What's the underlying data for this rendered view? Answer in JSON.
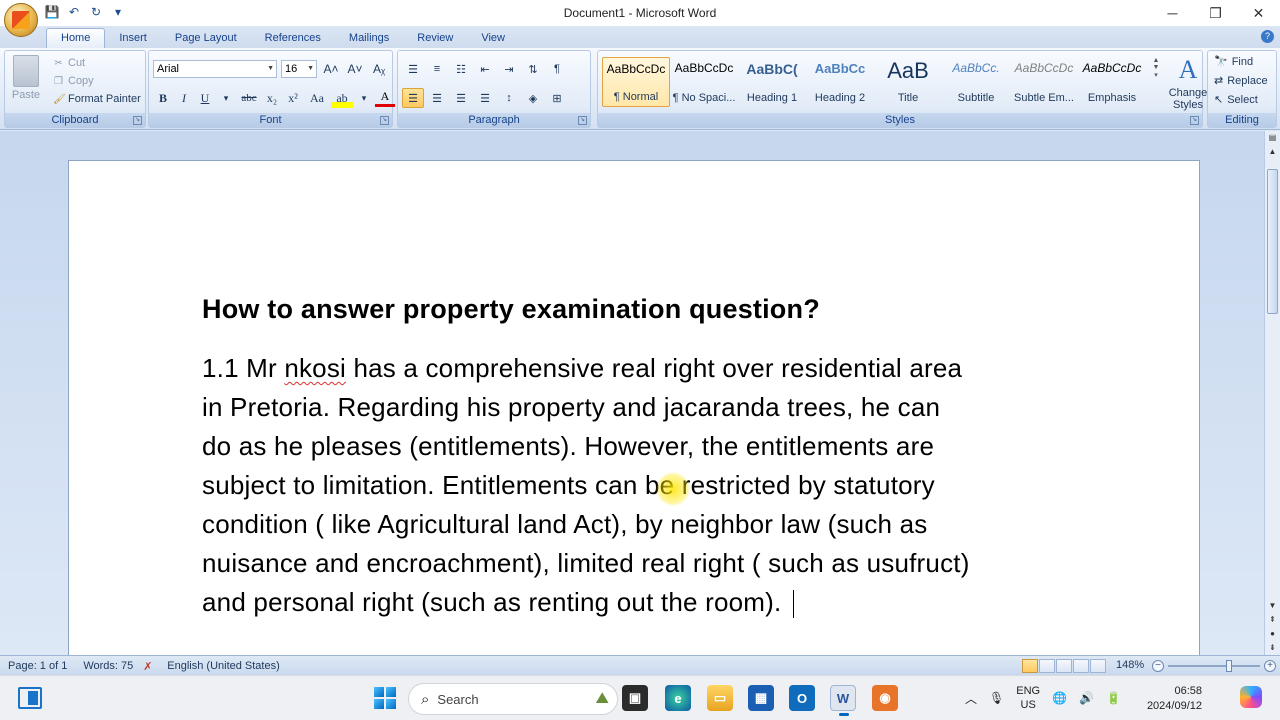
{
  "window": {
    "title": "Document1 - Microsoft Word",
    "controls": {
      "minimize": "─",
      "restore": "❐",
      "close": "✕"
    }
  },
  "qat": {
    "save": "💾",
    "undo": "↶",
    "redo": "↻",
    "more": "▾"
  },
  "tabs": [
    {
      "label": "Home",
      "active": true
    },
    {
      "label": "Insert"
    },
    {
      "label": "Page Layout"
    },
    {
      "label": "References"
    },
    {
      "label": "Mailings"
    },
    {
      "label": "Review"
    },
    {
      "label": "View"
    }
  ],
  "help": "?",
  "clipboard": {
    "paste": "Paste",
    "cut": "Cut",
    "copy": "Copy",
    "format_painter": "Format Painter",
    "group_label": "Clipboard"
  },
  "font": {
    "name": "Arial",
    "size": "16",
    "grow": "A˄",
    "shrink": "A˅",
    "clear": "Aᵪ",
    "bold": "B",
    "italic": "I",
    "underline": "U",
    "strike": "abc",
    "subscript": "x₂",
    "superscript": "x²",
    "change_case": "Aa",
    "highlight": "ab",
    "font_color": "A",
    "group_label": "Font"
  },
  "paragraph": {
    "pilcrow": "¶",
    "group_label": "Paragraph"
  },
  "styles": {
    "items": [
      {
        "sample": "AaBbCcDc",
        "name": "¶ Normal",
        "selected": true
      },
      {
        "sample": "AaBbCcDc",
        "name": "¶ No Spaci..."
      },
      {
        "sample": "AaBbC(",
        "name": "Heading 1"
      },
      {
        "sample": "AaBbCc",
        "name": "Heading 2"
      },
      {
        "sample": "AaB",
        "name": "Title"
      },
      {
        "sample": "AaBbCc.",
        "name": "Subtitle"
      },
      {
        "sample": "AaBbCcDc",
        "name": "Subtle Em..."
      },
      {
        "sample": "AaBbCcDc",
        "name": "Emphasis"
      }
    ],
    "change_styles": "Change Styles",
    "group_label": "Styles"
  },
  "editing": {
    "find": "Find",
    "replace": "Replace",
    "select": "Select",
    "group_label": "Editing"
  },
  "document": {
    "heading": "How to answer property examination question?",
    "lines": [
      [
        "1.1 Mr ",
        "nkosi",
        " has a comprehensive real right over residential area"
      ],
      [
        "in Pretoria. Regarding his property and jacaranda trees, he can"
      ],
      [
        "do as he pleases (entitlements). However, the entitlements are"
      ],
      [
        "subject to limitation. Entitlements can be restricted by statutory"
      ],
      [
        "condition ( like Agricultural land Act), by neighbor law (such as"
      ],
      [
        "nuisance and encroachment), limited real right ( such as usufruct)"
      ],
      [
        "and personal right (such as renting out the room). "
      ]
    ]
  },
  "status": {
    "page": "Page: 1 of 1",
    "words": "Words: 75",
    "language": "English (United States)",
    "zoom": "148%"
  },
  "taskbar": {
    "search": "Search",
    "lang_top": "ENG",
    "lang_bottom": "US",
    "time": "06:58",
    "date": "2024/09/12"
  }
}
